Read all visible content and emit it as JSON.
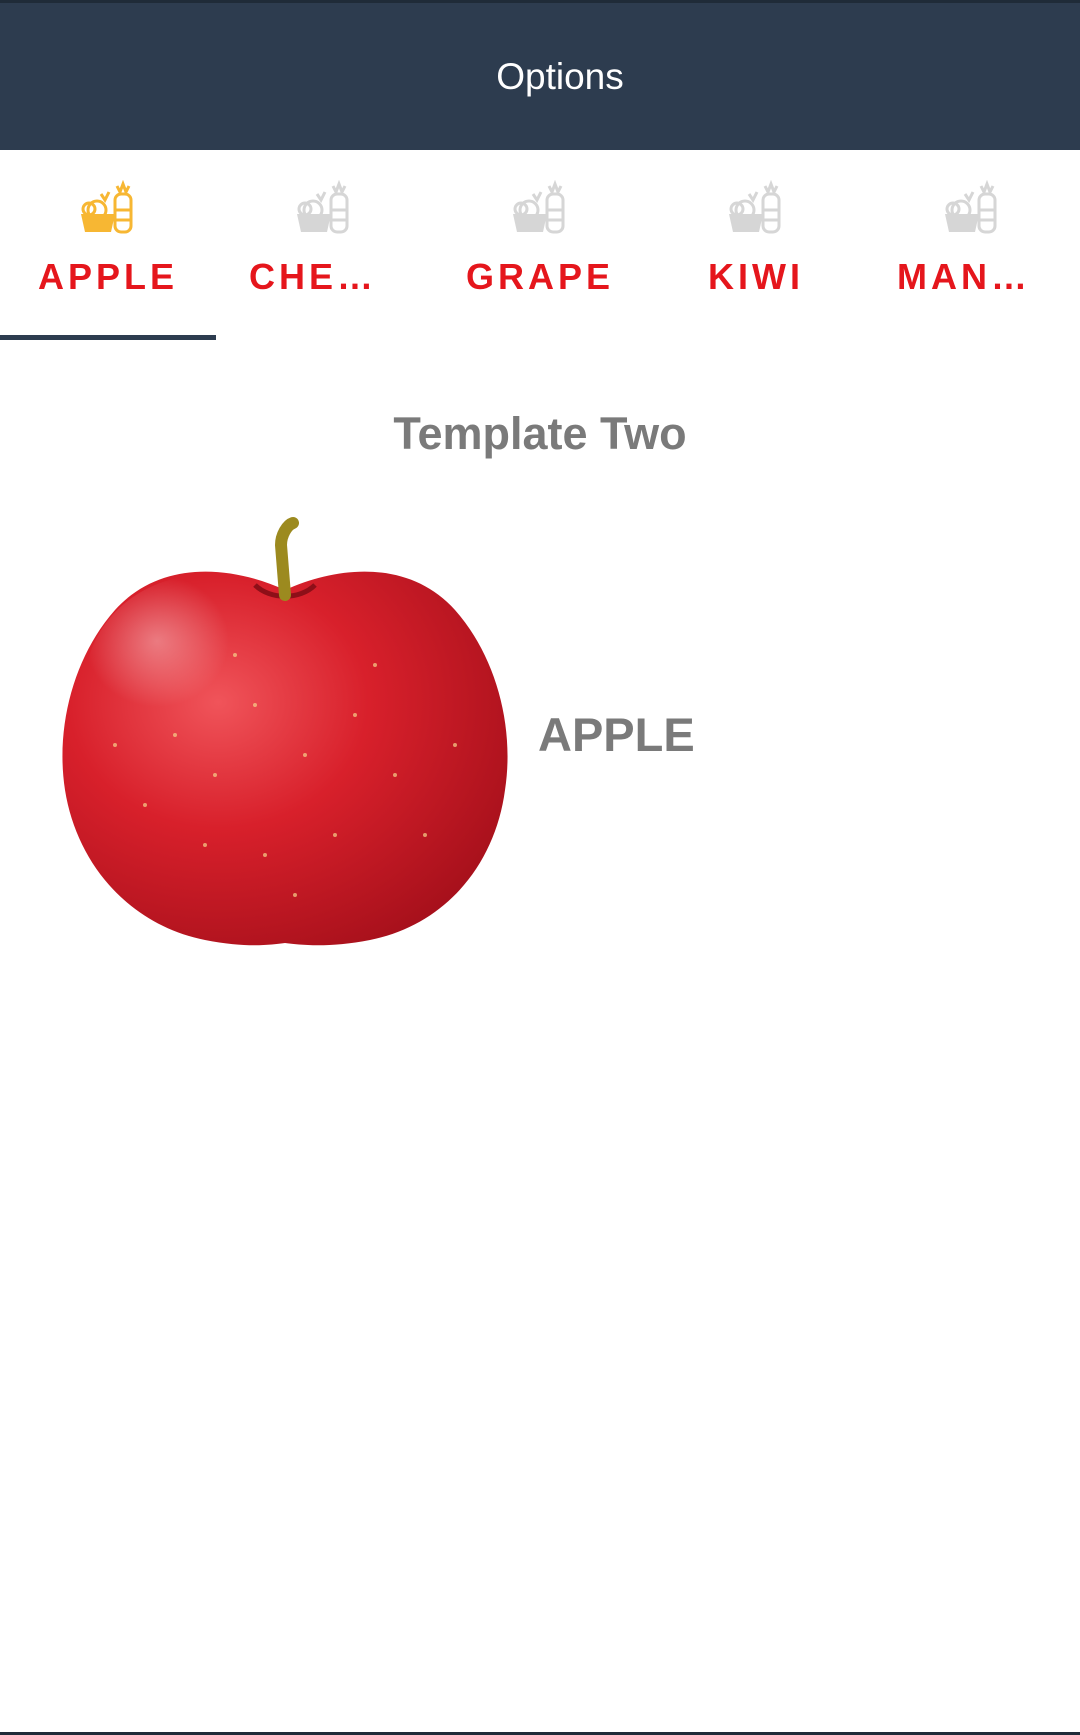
{
  "app_bar": {
    "title": "Options"
  },
  "tabs": [
    {
      "label": "APPLE",
      "icon": "fruits-basket-icon",
      "icon_color": "#f7b733",
      "selected": true
    },
    {
      "label": "CHER…",
      "icon": "fruits-basket-icon",
      "icon_color": "#d6d6d6",
      "selected": false
    },
    {
      "label": "GRAPE",
      "icon": "fruits-basket-icon",
      "icon_color": "#d6d6d6",
      "selected": false
    },
    {
      "label": "KIWI",
      "icon": "fruits-basket-icon",
      "icon_color": "#d6d6d6",
      "selected": false
    },
    {
      "label": "MANGO",
      "icon": "fruits-basket-icon",
      "icon_color": "#d6d6d6",
      "selected": false
    }
  ],
  "content": {
    "title": "Template Two",
    "fruit_name": "APPLE",
    "image": "apple-photo"
  },
  "colors": {
    "app_bar": "#2d3c4f",
    "tab_label": "#e5161c",
    "indicator": "#2d3c4f",
    "text_gray": "#7a7a7a"
  }
}
